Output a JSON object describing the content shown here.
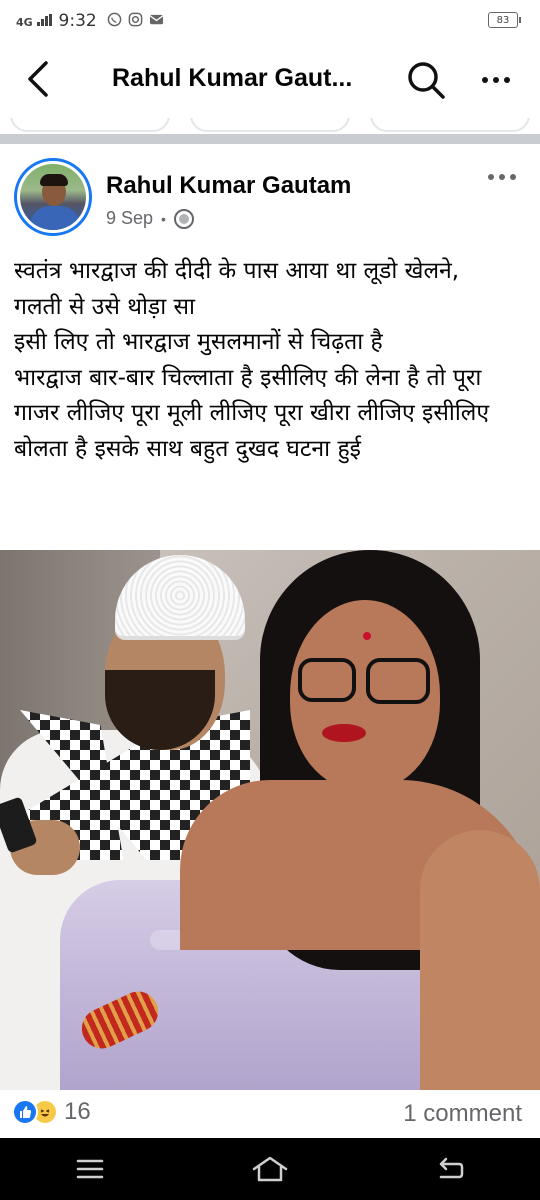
{
  "status_bar": {
    "network": "4G",
    "time": "9:32",
    "battery": "83"
  },
  "header": {
    "title": "Rahul Kumar Gaut..."
  },
  "post": {
    "author": "Rahul Kumar Gautam",
    "date": "9 Sep",
    "separator": "•",
    "text": "स्वतंत्र भारद्वाज की दीदी के पास आया था लूडो खेलने,\nगलती से उसे थोड़ा सा\nइसी लिए तो भारद्वाज मुसलमानों से चिढ़ता है\nभारद्वाज बार-बार चिल्लाता है इसीलिए की लेना है तो पूरा गाजर लीजिए पूरा मूली लीजिए पूरा खीरा लीजिए इसीलिए बोलता है इसके साथ बहुत दुखद घटना हुई"
  },
  "footer": {
    "reaction_count": "16",
    "comment_count": "1 comment"
  },
  "colors": {
    "accent": "#1877f2",
    "secondary_text": "#65676b",
    "separator": "#c9ccd1"
  }
}
